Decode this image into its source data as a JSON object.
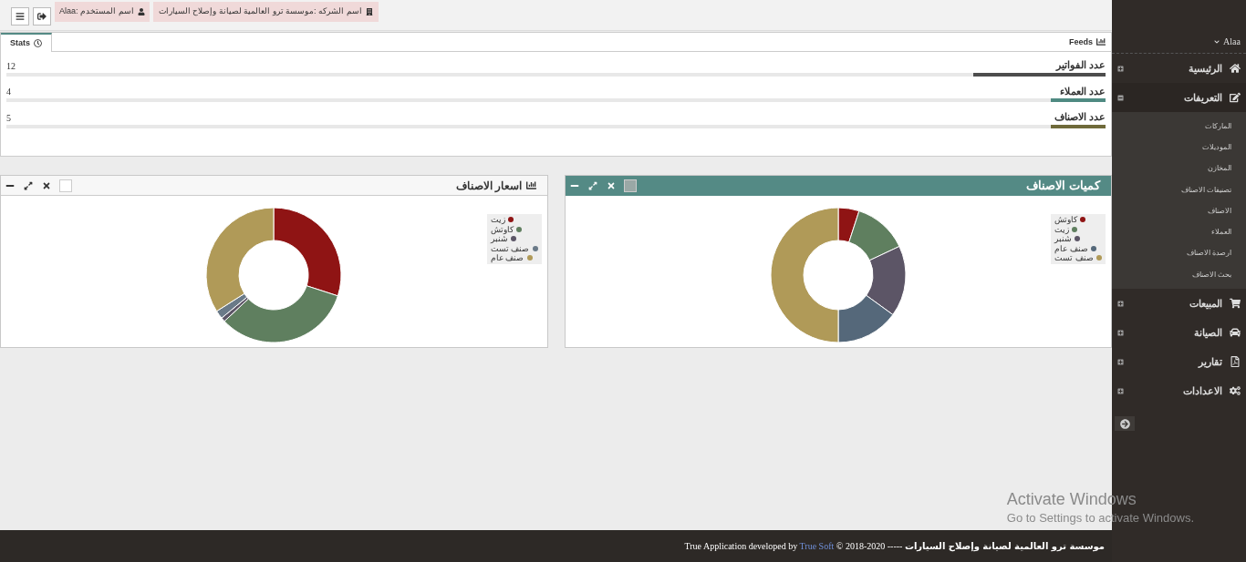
{
  "topbar": {
    "user": "اسم المستخدم :Alaa",
    "company": "اسم الشركه :موسسة ترو العالمية لصيانة وإصلاح السيارات"
  },
  "stats": {
    "tab": "Stats",
    "title": "Feeds",
    "rows": [
      {
        "label": "عدد الفواتير",
        "count": "12",
        "level": 0.12,
        "color": "#4d4d4d"
      },
      {
        "label": "عدد العملاء",
        "count": "4",
        "level": 0.05,
        "color": "#4f8a82"
      },
      {
        "label": "عدد الاصناف",
        "count": "5",
        "level": 0.05,
        "color": "#6f6a3a"
      }
    ]
  },
  "panels": [
    {
      "title": "كميات الاصناف",
      "highlighted": true,
      "legend": [
        {
          "label": "كاوتش",
          "color": "#8f1414"
        },
        {
          "label": "زيت",
          "color": "#5f7f5f"
        },
        {
          "label": "شنبر",
          "color": "#5c5566"
        },
        {
          "label": "صنف عام",
          "color": "#55687a"
        },
        {
          "label": "صنف تست",
          "color": "#b09a58"
        }
      ]
    },
    {
      "title": "اسعار الاصناف",
      "highlighted": false,
      "legend": [
        {
          "label": "زيت",
          "color": "#8f1414"
        },
        {
          "label": "كاوتش",
          "color": "#5f7f5f"
        },
        {
          "label": "شنبر",
          "color": "#5c5566"
        },
        {
          "label": "صنف تست",
          "color": "#6a7a88"
        },
        {
          "label": "صنف عام",
          "color": "#b09a58"
        }
      ]
    }
  ],
  "sidebar": {
    "user": "Alaa",
    "items": [
      {
        "label": "الرئيسية",
        "expanded": false
      },
      {
        "label": "التعريفات",
        "expanded": true,
        "children": [
          {
            "label": "الماركات"
          },
          {
            "label": "الموديلات"
          },
          {
            "label": "المخازن"
          },
          {
            "label": "تصنيفات الاصناف"
          },
          {
            "label": "الاصناف"
          },
          {
            "label": "العملاء"
          },
          {
            "label": "ارصدة الاصناف"
          },
          {
            "label": "بحث الاصناف"
          }
        ]
      },
      {
        "label": "المبيعات",
        "expanded": false
      },
      {
        "label": "الصيانة",
        "expanded": false
      },
      {
        "label": "تقارير",
        "expanded": false
      },
      {
        "label": "الاعدادات",
        "expanded": false
      }
    ]
  },
  "footer": {
    "prefix": "True Application developed by",
    "link": "True Soft",
    "suffix": "© 2018-2020 -----",
    "company": "موسسة ترو العالمية لصيانة وإصلاح السيارات"
  },
  "windows_notice": {
    "title": "Activate Windows",
    "subtitle": "Go to Settings to activate Windows."
  }
}
